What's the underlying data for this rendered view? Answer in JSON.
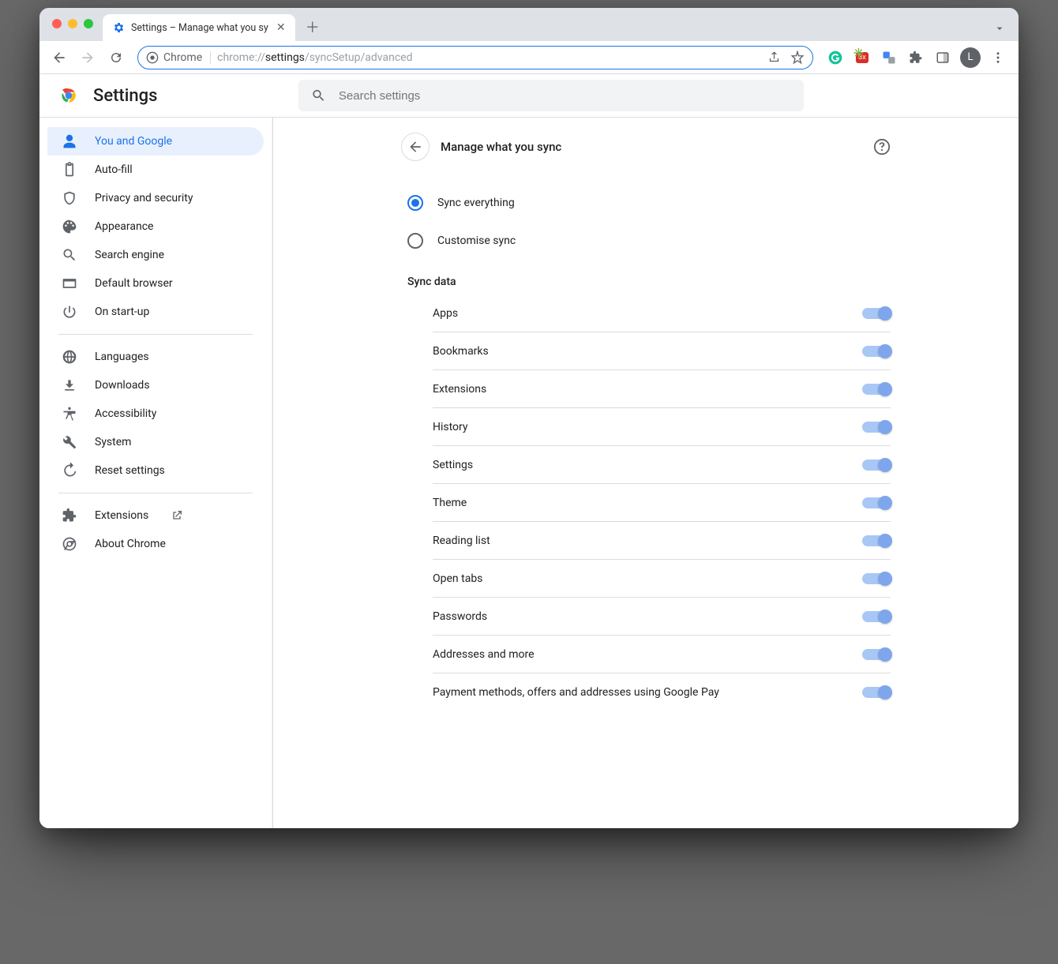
{
  "browser": {
    "tab_title": "Settings – Manage what you sy",
    "url_scheme": "chrome://",
    "url_bold": "settings",
    "url_rest": "/syncSetup/advanced",
    "omnibox_chip": "Chrome",
    "avatar_initial": "L"
  },
  "header": {
    "title": "Settings",
    "search_placeholder": "Search settings"
  },
  "sidebar": {
    "groups": [
      [
        {
          "icon": "person",
          "label": "You and Google",
          "active": true
        },
        {
          "icon": "clipboard",
          "label": "Auto-fill"
        },
        {
          "icon": "shield",
          "label": "Privacy and security"
        },
        {
          "icon": "palette",
          "label": "Appearance"
        },
        {
          "icon": "search",
          "label": "Search engine"
        },
        {
          "icon": "browser",
          "label": "Default browser"
        },
        {
          "icon": "power",
          "label": "On start-up"
        }
      ],
      [
        {
          "icon": "globe",
          "label": "Languages"
        },
        {
          "icon": "download",
          "label": "Downloads"
        },
        {
          "icon": "a11y",
          "label": "Accessibility"
        },
        {
          "icon": "wrench",
          "label": "System"
        },
        {
          "icon": "reset",
          "label": "Reset settings"
        }
      ],
      [
        {
          "icon": "puzzle",
          "label": "Extensions",
          "external": true
        },
        {
          "icon": "chrome-o",
          "label": "About Chrome"
        }
      ]
    ]
  },
  "page": {
    "title": "Manage what you sync",
    "radios": [
      {
        "label": "Sync everything",
        "selected": true
      },
      {
        "label": "Customise sync",
        "selected": false
      }
    ],
    "section_title": "Sync data",
    "sync_items": [
      "Apps",
      "Bookmarks",
      "Extensions",
      "History",
      "Settings",
      "Theme",
      "Reading list",
      "Open tabs",
      "Passwords",
      "Addresses and more",
      "Payment methods, offers and addresses using Google Pay"
    ]
  }
}
